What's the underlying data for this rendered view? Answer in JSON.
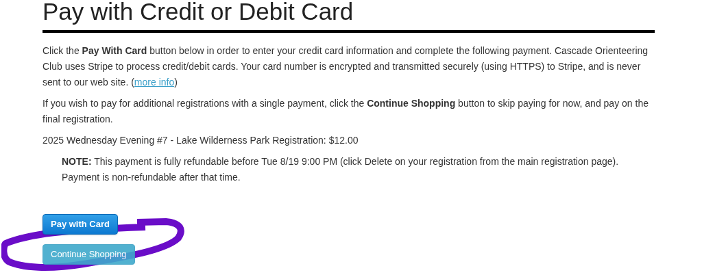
{
  "heading": "Pay with Credit or Debit Card",
  "intro": {
    "text": "Click the **Pay With Card** button below in order to enter your credit card information and complete the following payment. Cascade Orienteering Club uses Stripe to process credit/debit cards. Your card number is encrypted and transmitted securely (using HTTPS) to Stripe, and is never sent to our web site. (",
    "link": "more info",
    "after": ")"
  },
  "shopping_note": "If you wish to pay for additional registrations with a single payment, click the **Continue Shopping** button to skip paying for now, and pay on the final registration.",
  "registration": "2025 Wednesday Evening #7 - Lake Wilderness Park Registration: $12.00",
  "note": "**NOTE:** This payment is fully refundable before Tue 8/19 9:00 PM (click Delete on your registration from the main registration page). Payment is non-refundable after that time.",
  "buttons": [
    {
      "label": "Pay with Card",
      "kind": "primary",
      "disabled": false
    },
    {
      "label": "Continue Shopping",
      "kind": "info",
      "disabled": true
    }
  ]
}
